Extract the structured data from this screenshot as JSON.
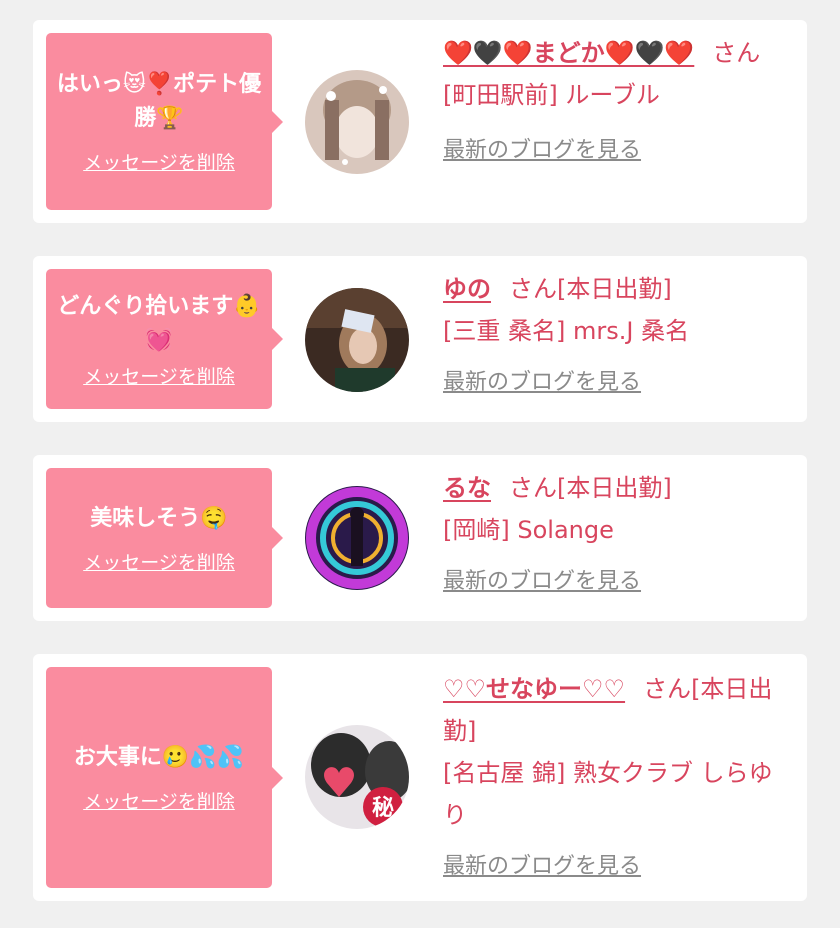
{
  "messages": [
    {
      "text": "はいっ😻❣️ポテト優勝🏆",
      "delete_label": "メッセージを削除",
      "name": "❤️🖤❤️まどか❤️🖤❤️",
      "suffix": "さん",
      "status": "",
      "shop": "[町田駅前] ルーブル",
      "blog_label": "最新のブログを見る",
      "avatar_colors": [
        "#d9c7bd",
        "#8a6f62",
        "#f1e4dc"
      ]
    },
    {
      "text": "どんぐり拾います👶💓",
      "delete_label": "メッセージを削除",
      "name": "ゆの",
      "suffix": "さん",
      "status": "[本日出勤]",
      "shop": "[三重 桑名] mrs.J 桑名",
      "blog_label": "最新のブログを見る",
      "avatar_colors": [
        "#3b2a22",
        "#a07a5c",
        "#1f3a2c"
      ]
    },
    {
      "text": "美味しそう🤤",
      "delete_label": "メッセージを削除",
      "name": "るな",
      "suffix": "さん",
      "status": "[本日出勤]",
      "shop": "[岡崎] Solange",
      "blog_label": "最新のブログを見る",
      "avatar_colors": [
        "#2a1a4a",
        "#c23ad8",
        "#35c9d8"
      ]
    },
    {
      "text": "お大事に🥲💦💦",
      "delete_label": "メッセージを削除",
      "name": "♡♡せなゆー♡♡",
      "suffix": "さん",
      "status": "[本日出勤]",
      "shop": "[名古屋 錦] 熟女クラブ しらゆり",
      "blog_label": "最新のブログを見る",
      "avatar_colors": [
        "#e8e4e8",
        "#2c2c2c",
        "#e84a6a"
      ]
    }
  ]
}
